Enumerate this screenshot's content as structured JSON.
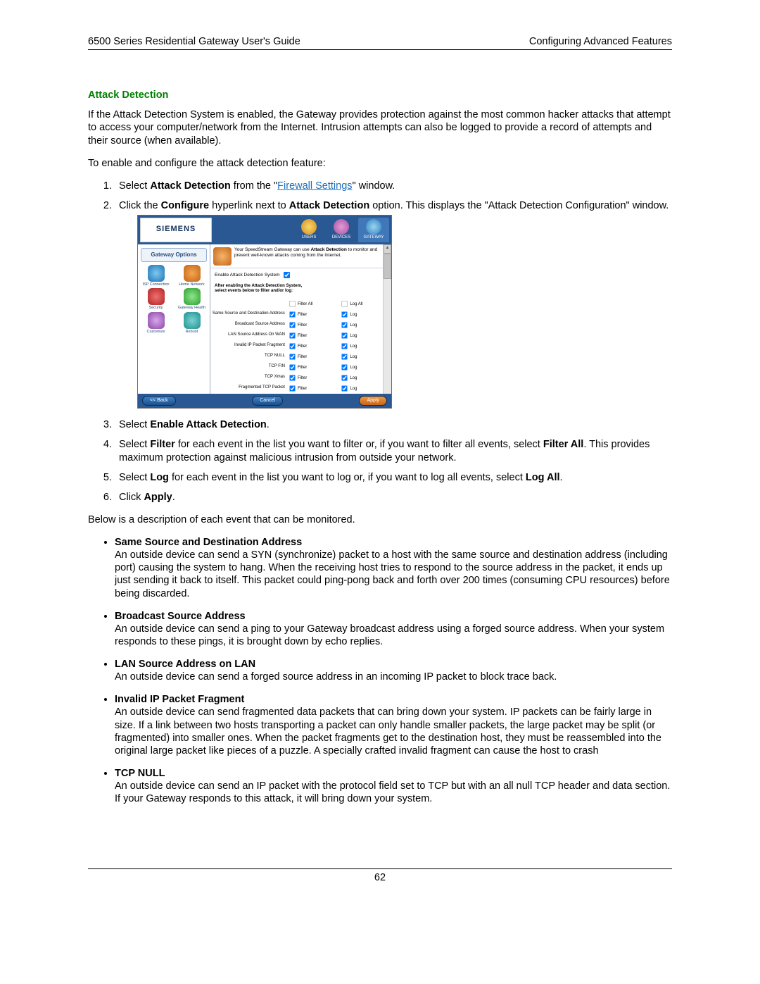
{
  "header": {
    "left": "6500 Series Residential Gateway User's Guide",
    "right": "Configuring Advanced Features"
  },
  "section_title": "Attack Detection",
  "intro_para": "If the Attack Detection System is enabled, the Gateway provides protection against the most common hacker attacks that attempt to access your computer/network from the Internet. Intrusion attempts can also be logged to provide a record of attempts and their source (when available).",
  "lead_in": "To enable and configure the attack detection feature:",
  "steps": {
    "s1_pre": "Select ",
    "s1_b": "Attack Detection",
    "s1_mid": " from the \"",
    "s1_link": "Firewall Settings",
    "s1_post": "\" window.",
    "s2_a": "Click the ",
    "s2_b1": "Configure",
    "s2_c": " hyperlink next to ",
    "s2_b2": "Attack Detection",
    "s2_d": " option. This displays the \"Attack Detection Configuration\" window.",
    "s3_a": "Select ",
    "s3_b": "Enable Attack Detection",
    "s3_c": ".",
    "s4_a": "Select ",
    "s4_b1": "Filter",
    "s4_b": " for each event in the list you want to filter or, if you want to filter all events, select ",
    "s4_b2": "Filter All",
    "s4_c": ". This provides maximum protection against malicious intrusion from outside your network.",
    "s5_a": "Select ",
    "s5_b1": "Log",
    "s5_b": " for each event in the list you want to log or, if you want to log all events, select ",
    "s5_b2": "Log All",
    "s5_c": ".",
    "s6_a": "Click ",
    "s6_b": "Apply",
    "s6_c": "."
  },
  "desc_intro": "Below is a description of each event that can be monitored.",
  "events": [
    {
      "title": "Same Source and Destination Address",
      "body": "An outside device can send a SYN (synchronize) packet to a host with the same source and destination address (including port) causing the system to hang. When the receiving host tries to respond to the source address in the packet, it ends up just sending it back to itself. This packet could ping-pong back and forth over 200 times (consuming CPU resources) before being discarded."
    },
    {
      "title": "Broadcast Source Address",
      "body": "An outside device can send a ping to your Gateway broadcast address using a forged source address. When your system responds to these pings, it is brought down by echo replies."
    },
    {
      "title": "LAN Source Address on LAN",
      "body": "An outside device can send a forged source address in an incoming IP packet to block trace back."
    },
    {
      "title": "Invalid IP Packet Fragment",
      "body": "An outside device can send fragmented data packets that can bring down your system. IP packets can be fairly large in size. If a link between two hosts transporting a packet can only handle smaller packets, the large packet may be split (or fragmented) into smaller ones. When the packet fragments get to the destination host, they must be reassembled into the original large packet like pieces of a puzzle. A specially crafted invalid fragment can cause the host to crash"
    },
    {
      "title": "TCP NULL",
      "body": "An outside device can send an IP packet with the protocol field set to TCP but with an all null TCP header and data section. If your Gateway responds to this attack, it will bring down your system."
    }
  ],
  "screenshot": {
    "brand": "SIEMENS",
    "tabs": {
      "users": "USERS",
      "devices": "DEVICES",
      "gateway": "GATEWAY"
    },
    "sidebar": {
      "title": "Gateway Options",
      "items": [
        "ISP Connection",
        "Home Network",
        "Security",
        "Gateway Health",
        "Customize",
        "Reboot"
      ]
    },
    "desc_text": "Your SpeedStream Gateway can use Attack Detection to monitor and prevent well-known attacks coming from the Internet.",
    "desc_bold": "Attack Detection",
    "enable_label": "Enable Attack Detection System",
    "note_line1": "After enabling the Attack Detection System,",
    "note_line2": "select events below to filter and/or log:",
    "col_filter_all": "Filter All",
    "col_log_all": "Log All",
    "col_filter": "Filter",
    "col_log": "Log",
    "rows": [
      "Same Source and Destination Address",
      "Broadcast Source Address",
      "LAN Source Address On WAN",
      "Invalid IP Packet Fragment",
      "TCP NULL",
      "TCP FIN",
      "TCP Xmas",
      "Fragmented TCP Packet"
    ],
    "btn_back": "<< Back",
    "btn_cancel": "Cancel",
    "btn_apply": "Apply"
  },
  "page_number": "62"
}
